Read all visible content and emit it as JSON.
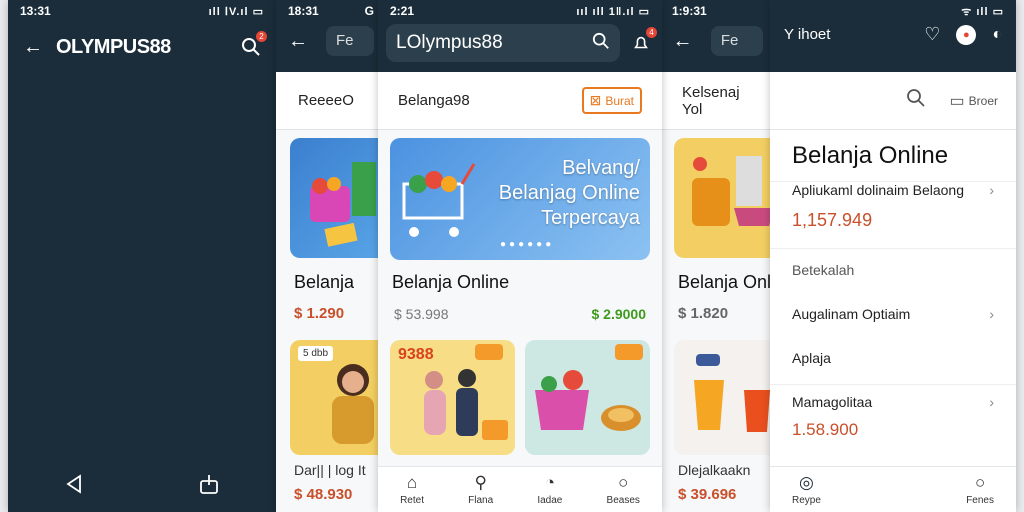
{
  "p1": {
    "time": "13:31",
    "status_icons": "ıll ⅠV.ıl ▭",
    "logo": "OLYMPUS88",
    "badge": "2"
  },
  "p2": {
    "time": "18:31",
    "status_icon": "G",
    "tab": "ReeeeO",
    "search_text": "Fe",
    "title": "Belanja",
    "price": "$ 1.290",
    "promo": "5 dbb",
    "bottom_title": "Dar|| | log It",
    "bottom_price": "$ 48.930"
  },
  "p3": {
    "time": "2:21",
    "status_icons": "ııl ıll 1‖.ıl ▭",
    "logo": "LOlympus88",
    "badge": "4",
    "tab": "Belanga98",
    "tab_right": "Burat",
    "banner_line1": "Belvang/",
    "banner_line2": "Belanjag Online",
    "banner_line3": "Terpercaya",
    "section_title": "Belanja Online",
    "price_old": "$ 53.998",
    "price_new": "$ 2.9000",
    "promo1": "9388",
    "promo2": "",
    "promo_tag": "",
    "nav": [
      "Retet",
      "Flana",
      "Iadae",
      "Beases"
    ]
  },
  "p4": {
    "time": "1:9:31",
    "search_text": "Fe",
    "tab": "Kelsenaj Yol",
    "title": "Belanja Onl",
    "price": "$ 1.820",
    "bottom_title": "Dlejalkaakn",
    "bottom_price": "$ 39.696"
  },
  "p5": {
    "status_icons": "ᯤ ıll ▭",
    "header_text": "Y ihoet",
    "search_label": "Broer",
    "title": "Belanja Online",
    "rows": [
      {
        "label": "Apliukaml dolinaim Belaong",
        "value": "1,157.949",
        "chev": "›"
      },
      {
        "label": "Betekalah",
        "value": "",
        "chev": ""
      },
      {
        "label": "Augalinam Optiaim",
        "value": "",
        "chev": "›"
      },
      {
        "label": "Aplaja",
        "value": "",
        "chev": ""
      },
      {
        "label": "Mamagolitaa",
        "value": "1.58.900",
        "chev": "›"
      }
    ],
    "nav": [
      "Reype",
      "Fenes"
    ]
  },
  "colors": {
    "dark": "#1b2d3a",
    "accent": "#e8791f",
    "price": "#c8502a",
    "green": "#3f9a1f"
  }
}
